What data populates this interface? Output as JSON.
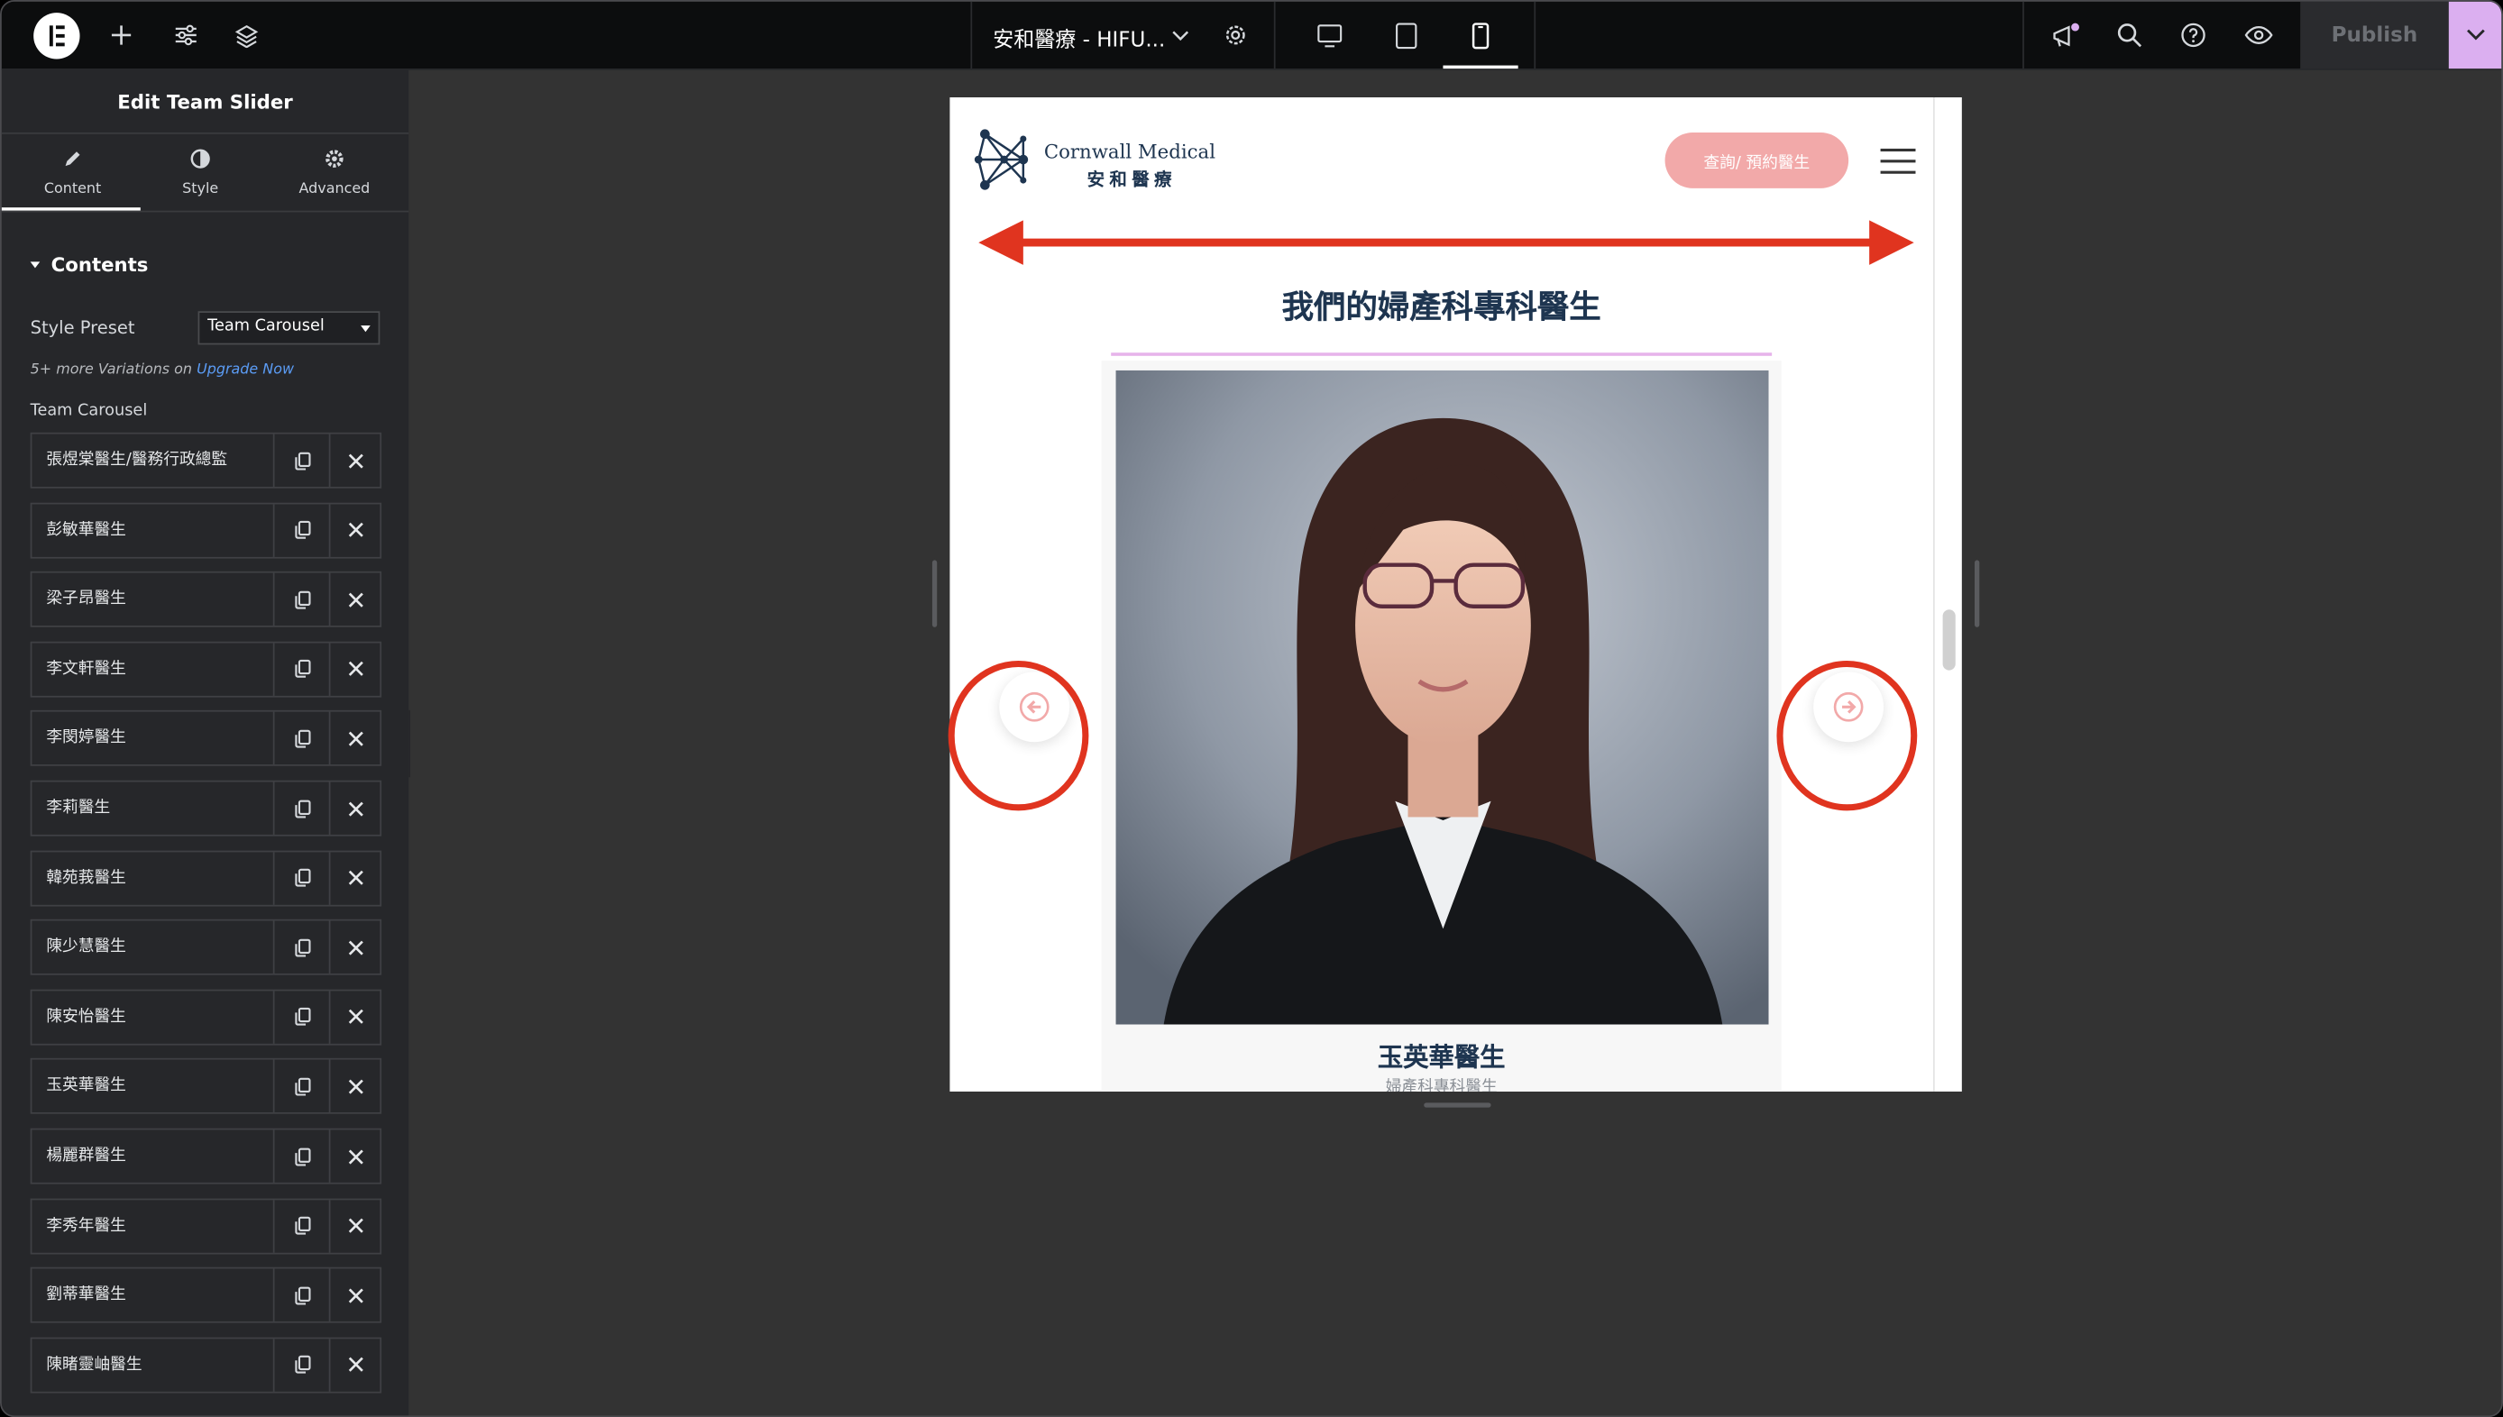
{
  "topbar": {
    "document_title": "安和醫療 - HIFU...",
    "publish_label": "Publish",
    "icons": [
      "elementor-logo-icon",
      "add-icon",
      "settings-sliders-icon",
      "layers-icon",
      "chevron-down-icon",
      "gear-icon",
      "desktop-icon",
      "tablet-icon",
      "mobile-icon",
      "megaphone-icon",
      "search-icon",
      "help-icon",
      "eye-icon",
      "chevron-down-icon"
    ],
    "colors": {
      "bar": "#0c0d0e",
      "publish_more": "#dbaff0"
    }
  },
  "sidebar": {
    "panel_title": "Edit Team Slider",
    "tabs": [
      {
        "label": "Content",
        "icon": "pencil-icon"
      },
      {
        "label": "Style",
        "icon": "contrast-icon"
      },
      {
        "label": "Advanced",
        "icon": "gear-icon"
      }
    ],
    "section_title": "Contents",
    "style_preset_label": "Style Preset",
    "style_preset_value": "Team Carousel",
    "more_variations_text": "5+ more Variations on ",
    "upgrade_link": "Upgrade Now",
    "repeater_label": "Team Carousel",
    "items": [
      "張煜棠醫生/醫務行政總監",
      "彭敏華醫生",
      "梁子昂醫生",
      "李文軒醫生",
      "李閔婷醫生",
      "李莉醫生",
      "韓苑莪醫生",
      "陳少慧醫生",
      "陳安怡醫生",
      "玉英華醫生",
      "楊麗群醫生",
      "李秀年醫生",
      "劉蒂華醫生",
      "陳睹靈岫醫生"
    ]
  },
  "preview": {
    "brand_en": "Cornwall Medical",
    "brand_zh": "安和醫療",
    "book_button": "查詢/ 預約醫生",
    "section_title": "我們的婦產科專科醫生",
    "member_name": "玉英華醫生",
    "member_role": "婦產科專科醫生",
    "colors": {
      "navy": "#1e3550",
      "book_button": "#f2a9a9",
      "divider": "#e6b3ea",
      "annotation": "#e0341f"
    }
  }
}
